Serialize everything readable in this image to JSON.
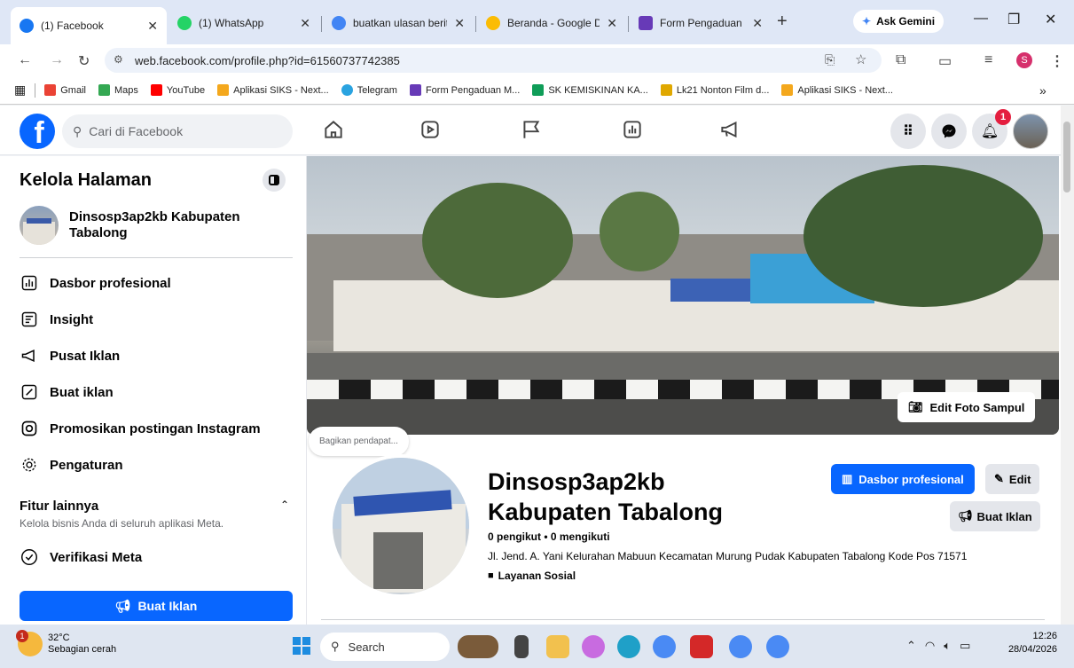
{
  "browser": {
    "tabs": [
      {
        "title": "(1) Facebook",
        "color": "#1877f2"
      },
      {
        "title": "(1) WhatsApp",
        "color": "#25d366"
      },
      {
        "title": "buatkan ulasan berita",
        "color": "#4285f4"
      },
      {
        "title": "Beranda - Google Dri",
        "color": "#fbbc04"
      },
      {
        "title": "Form Pengaduan Ma",
        "color": "#673ab7"
      }
    ],
    "gemini_label": "Ask Gemini",
    "url": "web.facebook.com/profile.php?id=61560737742385",
    "bookmarks": [
      {
        "label": "Gmail",
        "color": "#ea4335"
      },
      {
        "label": "Maps",
        "color": "#34a853"
      },
      {
        "label": "YouTube",
        "color": "#ff0000"
      },
      {
        "label": "Aplikasi SIKS - Next...",
        "color": "#f4a81d"
      },
      {
        "label": "Telegram",
        "color": "#2aa3e0"
      },
      {
        "label": "Form Pengaduan M...",
        "color": "#673ab7"
      },
      {
        "label": "SK KEMISKINAN KA...",
        "color": "#0f9d58"
      },
      {
        "label": "Lk21 Nonton Film d...",
        "color": "#e0a800"
      },
      {
        "label": "Aplikasi SIKS - Next...",
        "color": "#f4a81d"
      }
    ],
    "bookmarks_more": "»",
    "profile_initial": "S"
  },
  "fb": {
    "logo": "f",
    "search_placeholder": "Cari di Facebook",
    "notif_count": "1"
  },
  "sidebar": {
    "title": "Kelola Halaman",
    "page_name": "Dinsosp3ap2kb Kabupaten Tabalong",
    "items": [
      {
        "label": "Dasbor profesional",
        "icon": "dashboard-icon"
      },
      {
        "label": "Insight",
        "icon": "insight-icon"
      },
      {
        "label": "Pusat Iklan",
        "icon": "megaphone-icon"
      },
      {
        "label": "Buat iklan",
        "icon": "pencil-icon"
      },
      {
        "label": "Promosikan postingan Instagram",
        "icon": "instagram-icon"
      },
      {
        "label": "Pengaturan",
        "icon": "gear-icon"
      }
    ],
    "more_title": "Fitur lainnya",
    "more_desc": "Kelola bisnis Anda di seluruh aplikasi Meta.",
    "verify": "Verifikasi Meta",
    "button": "Buat Iklan"
  },
  "profile": {
    "edit_cover": "Edit Foto Sampul",
    "bubble": "Bagikan pendapat...",
    "name": "Dinsosp3ap2kb Kabupaten Tabalong",
    "stats": "0 pengikut • 0 mengikuti",
    "address": "Jl. Jend. A. Yani Kelurahan Mabuun Kecamatan Murung Pudak Kabupaten Tabalong Kode Pos 71571",
    "category": "Layanan Sosial",
    "btn_dashboard": "Dasbor profesional",
    "btn_edit": "Edit",
    "btn_ad": "Buat Iklan"
  },
  "taskbar": {
    "temp": "32°C",
    "weather": "Sebagian cerah",
    "weather_badge": "1",
    "search": "Search",
    "time": "12:26",
    "date": "28/04/2026"
  }
}
